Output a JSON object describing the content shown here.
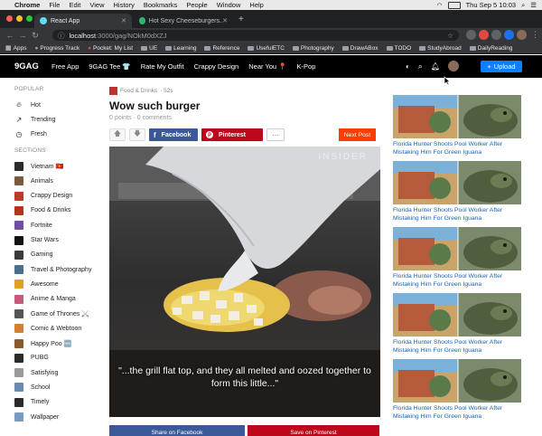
{
  "menubar": {
    "app": "Chrome",
    "items": [
      "File",
      "Edit",
      "View",
      "History",
      "Bookmarks",
      "People",
      "Window",
      "Help"
    ],
    "clock": "Thu Sep 5  10:03"
  },
  "tabs": [
    {
      "title": "React App",
      "active": true
    },
    {
      "title": "Hot Sexy Cheeseburgers... – A",
      "active": false
    }
  ],
  "address": {
    "host": "localhost",
    "path": ":3000/gag/NOkM0dXZJ"
  },
  "bookmarks": [
    "Apps",
    "Progress Track",
    "Pocket: My List",
    "UE",
    "Learning",
    "Reference",
    "UsefulETC",
    "Photography",
    "DrawABox",
    "TODO",
    "StudyAbroad",
    "DailyReading"
  ],
  "header": {
    "logo": "9GAG",
    "nav": [
      "Free App",
      "9GAG Tee 👕",
      "Rate My Outfit",
      "Crappy Design",
      "Near You 📍",
      "K-Pop"
    ],
    "upload_label": "Upload"
  },
  "sidebar": {
    "popular_heading": "POPULAR",
    "popular": [
      {
        "label": "Hot",
        "icon": "fire-icon"
      },
      {
        "label": "Trending",
        "icon": "trending-icon"
      },
      {
        "label": "Fresh",
        "icon": "clock-icon"
      }
    ],
    "sections_heading": "SECTIONS",
    "sections": [
      {
        "label": "Vietnam 🇻🇳",
        "color": "#2b2b2b"
      },
      {
        "label": "Animals",
        "color": "#7a5a3a"
      },
      {
        "label": "Crappy Design",
        "color": "#c0392b"
      },
      {
        "label": "Food & Drinks",
        "color": "#b5341f"
      },
      {
        "label": "Fortnite",
        "color": "#6f4f9f"
      },
      {
        "label": "Star Wars",
        "color": "#111111"
      },
      {
        "label": "Gaming",
        "color": "#3a3a3a"
      },
      {
        "label": "Travel & Photography",
        "color": "#4a6f8a"
      },
      {
        "label": "Awesome",
        "color": "#e0a020"
      },
      {
        "label": "Anime & Manga",
        "color": "#c75a7a"
      },
      {
        "label": "Game of Thrones ⚔️",
        "color": "#555555"
      },
      {
        "label": "Comic & Webtoon",
        "color": "#d08030"
      },
      {
        "label": "Happy Poo 🆕",
        "color": "#8a5a2a"
      },
      {
        "label": "PUBG",
        "color": "#2a2a2a"
      },
      {
        "label": "Satisfying",
        "color": "#9a9a9a"
      },
      {
        "label": "School",
        "color": "#6a8ab0"
      },
      {
        "label": "Timely",
        "color": "#2a2a2a"
      },
      {
        "label": "Wallpaper",
        "color": "#7a9ac0"
      }
    ]
  },
  "post": {
    "section": "Food & Drinks",
    "age": "· 52s",
    "title": "Wow such burger",
    "points": "0 points",
    "comments": "0 comments",
    "facebook_label": "Facebook",
    "pinterest_label": "Pinterest",
    "more_label": "···",
    "next_label": "Next Post",
    "watermark": "INSIDER",
    "caption": "\"...the grill flat top, and they all melted and oozed together to form this little...\"",
    "share_fb": "Share on Facebook",
    "share_pin": "Save on Pinterest"
  },
  "rail": [
    {
      "title": "Florida Hunter Shoots Pool Worker After Mistaking Him For Green Iguana"
    },
    {
      "title": "Florida Hunter Shoots Pool Worker After Mistaking Him For Green Iguana"
    },
    {
      "title": "Florida Hunter Shoots Pool Worker After Mistaking Him For Green Iguana"
    },
    {
      "title": "Florida Hunter Shoots Pool Worker After Mistaking Him For Green Iguana"
    },
    {
      "title": "Florida Hunter Shoots Pool Worker After Mistaking Him For Green Iguana"
    }
  ],
  "colors": {
    "accent": "#0a7fff",
    "facebook": "#3b5998",
    "pinterest": "#bd081c",
    "next": "#ff3d00"
  }
}
